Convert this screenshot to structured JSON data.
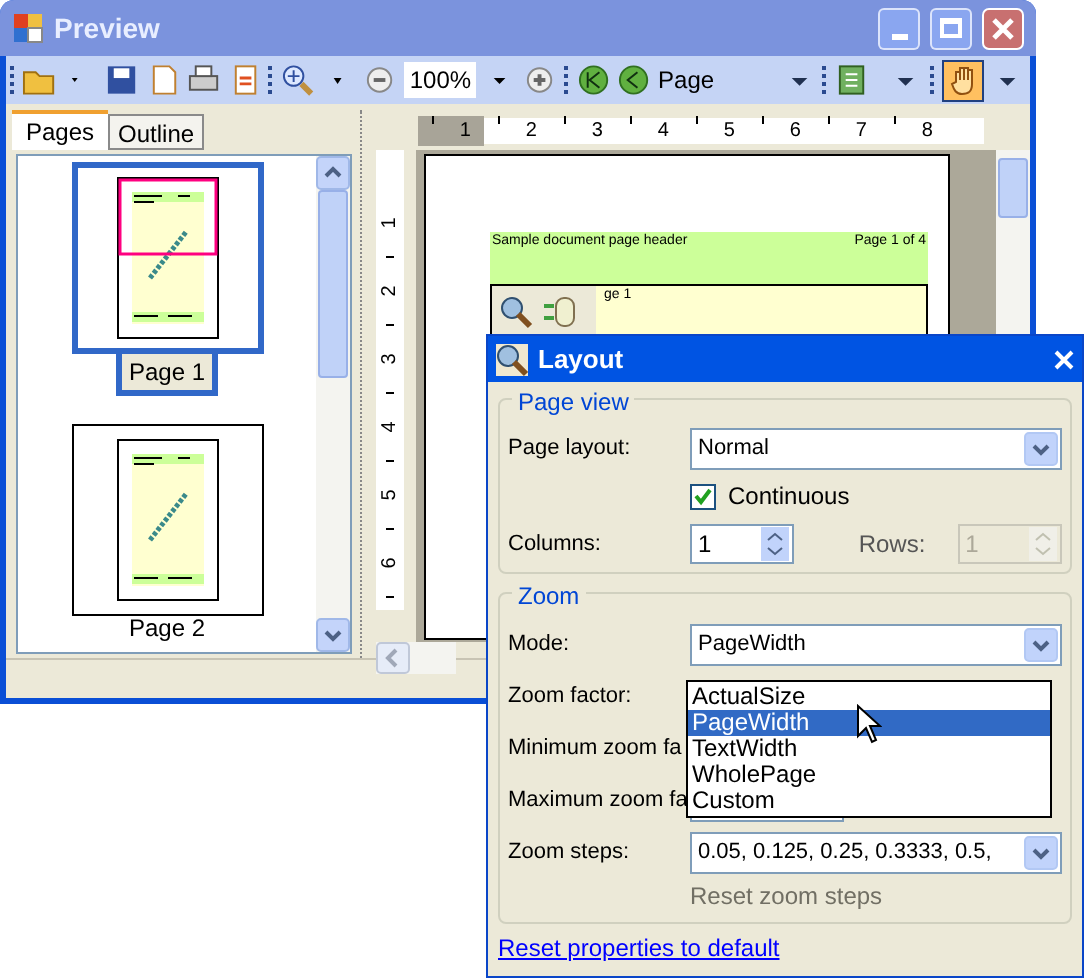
{
  "window": {
    "title": "Preview"
  },
  "toolbar": {
    "zoom_value": "100%",
    "page_label": "Page",
    "pan_tool": {
      "selected": true
    }
  },
  "ruler": {
    "horizontal": [
      "1",
      "2",
      "3",
      "4",
      "5",
      "6",
      "7",
      "8"
    ],
    "vertical": [
      "1",
      "2",
      "3",
      "4",
      "5",
      "6"
    ]
  },
  "side_tabs": [
    {
      "label": "Pages",
      "selected": true
    },
    {
      "label": "Outline",
      "selected": false
    }
  ],
  "thumbnails": [
    {
      "label": "Page 1",
      "selected": true
    },
    {
      "label": "Page 2",
      "selected": false
    }
  ],
  "document": {
    "header_left": "Sample document page header",
    "header_right": "Page 1 of 4",
    "body_text": "ge 1"
  },
  "dialog": {
    "title": "Layout",
    "page_view": {
      "legend": "Page view",
      "page_layout_label": "Page layout:",
      "page_layout": "Normal",
      "continuous": {
        "label": "Continuous",
        "checked": true
      },
      "columns_label": "Columns:",
      "columns": "1",
      "rows_label": "Rows:",
      "rows": {
        "value": "1",
        "disabled": true
      }
    },
    "zoom": {
      "legend": "Zoom",
      "mode_label": "Mode:",
      "mode": "PageWidth",
      "options": [
        {
          "label": "ActualSize",
          "selected": false
        },
        {
          "label": "PageWidth",
          "selected": true
        },
        {
          "label": "TextWidth",
          "selected": false
        },
        {
          "label": "WholePage",
          "selected": false
        },
        {
          "label": "Custom",
          "selected": false
        }
      ],
      "zoom_factor_label": "Zoom factor:",
      "min_label": "Minimum zoom fa",
      "max_label": "Maximum zoom fa",
      "steps_label": "Zoom steps:",
      "steps": "0.05, 0.125, 0.25, 0.3333, 0.5,",
      "reset_steps": "Reset zoom steps"
    },
    "reset_link": "Reset properties to default"
  }
}
